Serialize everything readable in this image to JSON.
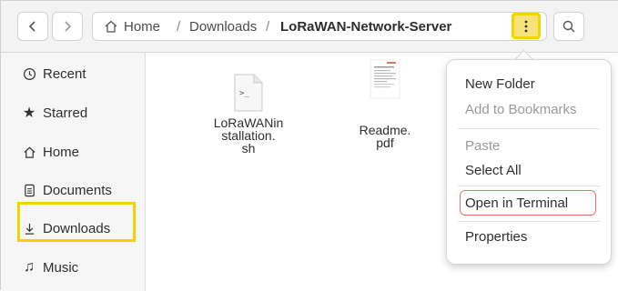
{
  "header": {
    "breadcrumbs": {
      "home": "Home",
      "separator": "/",
      "downloads": "Downloads",
      "current": "LoRaWAN-Network-Server"
    },
    "icons": {
      "back": "chevron-left-icon",
      "forward": "chevron-right-icon",
      "home": "home-icon",
      "menu": "kebab-menu-icon",
      "search": "search-icon"
    }
  },
  "sidebar": {
    "items": [
      {
        "label": "Recent",
        "icon": "clock-icon"
      },
      {
        "label": "Starred",
        "icon": "star-icon"
      },
      {
        "label": "Home",
        "icon": "home-icon"
      },
      {
        "label": "Documents",
        "icon": "document-icon"
      },
      {
        "label": "Downloads",
        "icon": "download-icon"
      },
      {
        "label": "Music",
        "icon": "music-icon"
      }
    ]
  },
  "files": [
    {
      "name_line1": "LoRaWANin",
      "name_line2": "stallation.",
      "name_line3": "sh",
      "icon": "shell-script-icon",
      "icon_text": ">_"
    },
    {
      "name_line1": "Readme.",
      "name_line2": "pdf",
      "icon": "pdf-thumbnail-icon"
    }
  ],
  "menu": {
    "new_folder": "New Folder",
    "add_bookmarks": "Add to Bookmarks",
    "paste": "Paste",
    "select_all": "Select All",
    "open_terminal": "Open in Terminal",
    "properties": "Properties"
  },
  "colors": {
    "highlight_yellow": "#f2d500",
    "terminal_outline": "#e0786a",
    "header_bg": "#f3f3f3",
    "sidebar_bg": "#f6f6f6"
  }
}
